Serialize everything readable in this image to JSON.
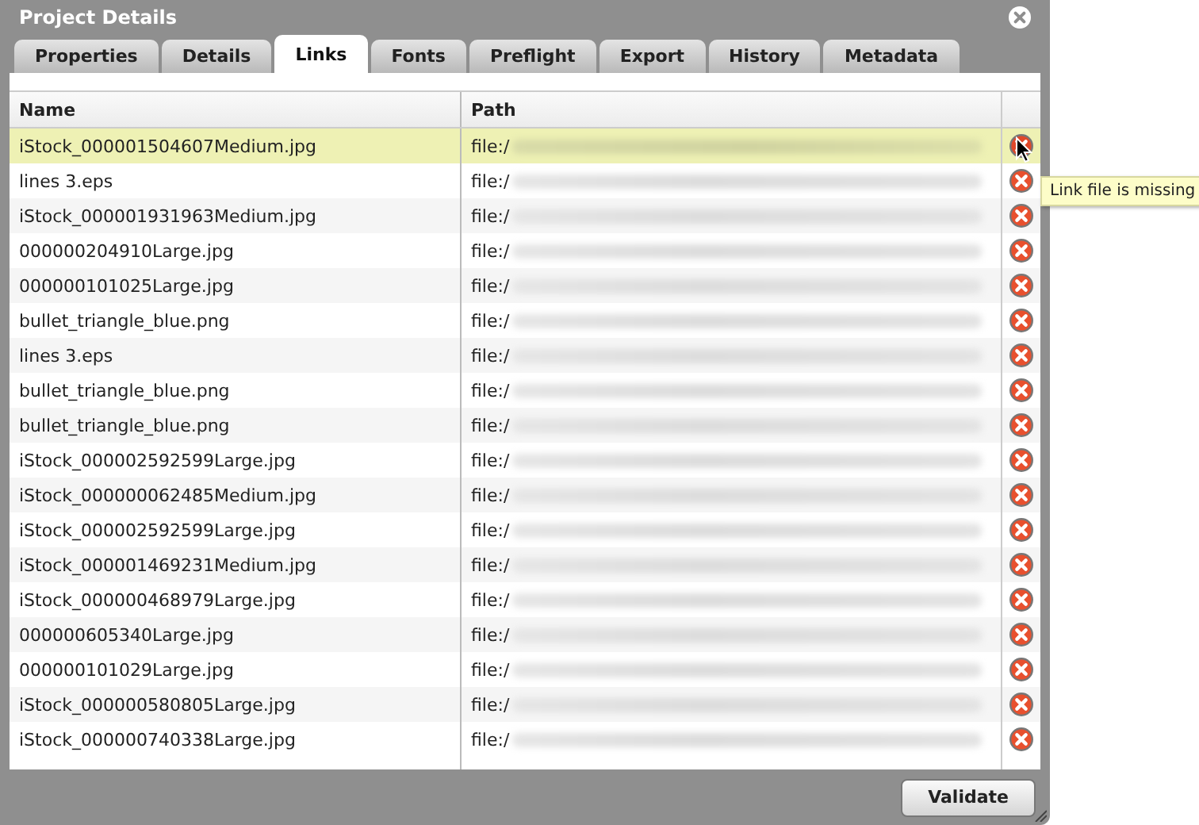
{
  "window": {
    "title": "Project Details"
  },
  "tabs": [
    {
      "label": "Properties",
      "selected": false
    },
    {
      "label": "Details",
      "selected": false
    },
    {
      "label": "Links",
      "selected": true
    },
    {
      "label": "Fonts",
      "selected": false
    },
    {
      "label": "Preflight",
      "selected": false
    },
    {
      "label": "Export",
      "selected": false
    },
    {
      "label": "History",
      "selected": false
    },
    {
      "label": "Metadata",
      "selected": false
    }
  ],
  "table": {
    "columns": [
      "Name",
      "Path"
    ],
    "rows": [
      {
        "name": "iStock_000001504607Medium.jpg",
        "path": "file:/",
        "selected": true
      },
      {
        "name": "lines 3.eps",
        "path": "file:/",
        "selected": false
      },
      {
        "name": "iStock_000001931963Medium.jpg",
        "path": "file:/",
        "selected": false
      },
      {
        "name": "000000204910Large.jpg",
        "path": "file:/",
        "selected": false
      },
      {
        "name": "000000101025Large.jpg",
        "path": "file:/",
        "selected": false
      },
      {
        "name": "bullet_triangle_blue.png",
        "path": "file:/",
        "selected": false
      },
      {
        "name": "lines 3.eps",
        "path": "file:/",
        "selected": false
      },
      {
        "name": "bullet_triangle_blue.png",
        "path": "file:/",
        "selected": false
      },
      {
        "name": "bullet_triangle_blue.png",
        "path": "file:/",
        "selected": false
      },
      {
        "name": "iStock_000002592599Large.jpg",
        "path": "file:/",
        "selected": false
      },
      {
        "name": "iStock_000000062485Medium.jpg",
        "path": "file:/",
        "selected": false
      },
      {
        "name": "iStock_000002592599Large.jpg",
        "path": "file:/",
        "selected": false
      },
      {
        "name": "iStock_000001469231Medium.jpg",
        "path": "file:/",
        "selected": false
      },
      {
        "name": "iStock_000000468979Large.jpg",
        "path": "file:/",
        "selected": false
      },
      {
        "name": "000000605340Large.jpg",
        "path": "file:/",
        "selected": false
      },
      {
        "name": "000000101029Large.jpg",
        "path": "file:/",
        "selected": false
      },
      {
        "name": "iStock_000000580805Large.jpg",
        "path": "file:/",
        "selected": false
      },
      {
        "name": "iStock_000000740338Large.jpg",
        "path": "file:/",
        "selected": false
      }
    ]
  },
  "tooltip": {
    "text": "Link file is missing"
  },
  "buttons": [
    "Validate"
  ]
}
